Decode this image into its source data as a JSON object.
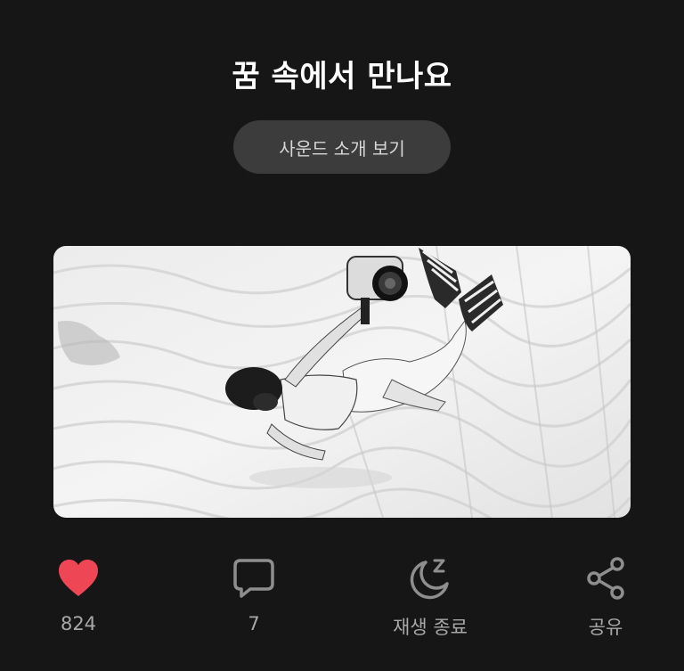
{
  "title": "꿈 속에서 만나요",
  "intro_button": "사운드 소개 보기",
  "cover": {
    "icon": "underwater-photographer-image"
  },
  "actions": {
    "like": {
      "label": "824",
      "icon": "heart-icon",
      "color": "#ef4655"
    },
    "comment": {
      "label": "7",
      "icon": "comment-icon"
    },
    "stop": {
      "label": "재생 종료",
      "icon": "moon-sleep-icon"
    },
    "share": {
      "label": "공유",
      "icon": "share-icon"
    }
  },
  "colors": {
    "background": "#161616",
    "button_bg": "#3c3c3c",
    "icon_gray": "#8e8e8e",
    "label_gray": "#a8a8a8",
    "like_red": "#ef4655"
  }
}
